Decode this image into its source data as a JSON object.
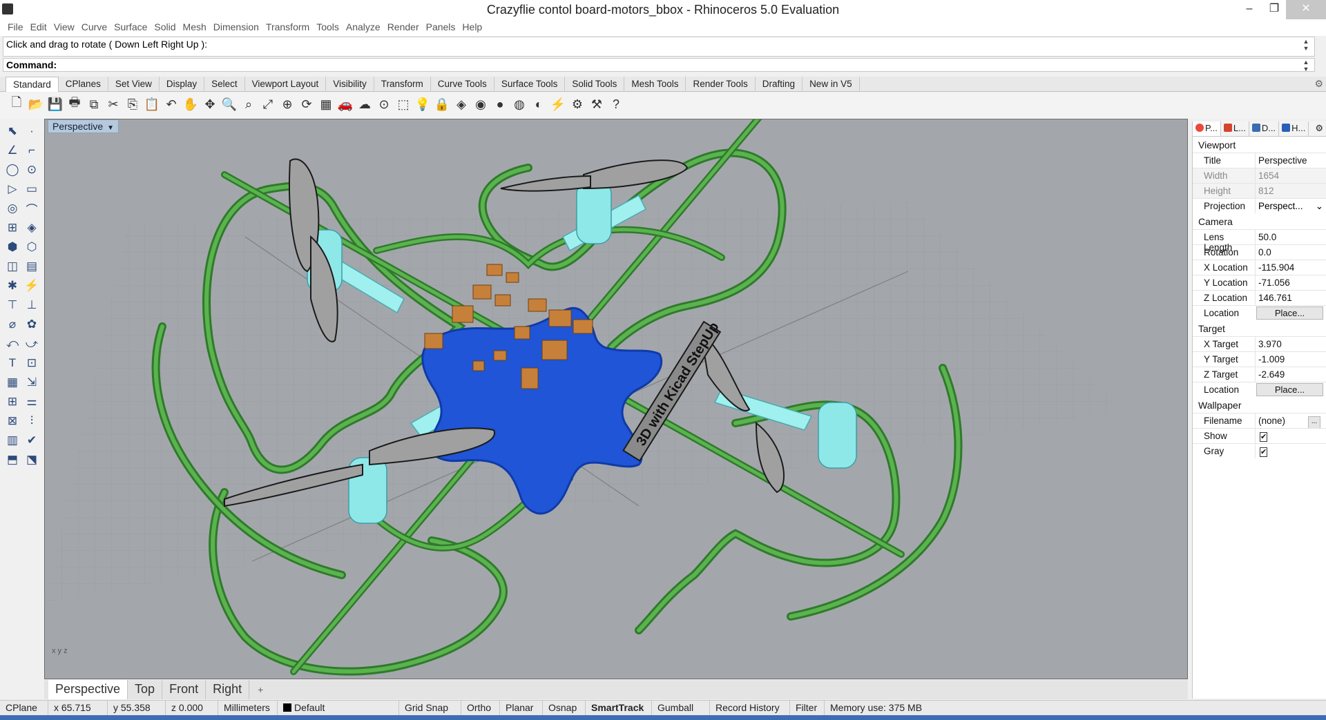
{
  "window": {
    "title": "Crazyflie contol board-motors_bbox - Rhinoceros 5.0 Evaluation",
    "minimize": "–",
    "maximize": "❐",
    "close": "✕"
  },
  "menu": [
    "File",
    "Edit",
    "View",
    "Curve",
    "Surface",
    "Solid",
    "Mesh",
    "Dimension",
    "Transform",
    "Tools",
    "Analyze",
    "Render",
    "Panels",
    "Help"
  ],
  "command": {
    "history": "Click and drag to rotate ( Down  Left  Right  Up ):",
    "prompt": "Command:"
  },
  "toolbar_tabs": [
    "Standard",
    "CPlanes",
    "Set View",
    "Display",
    "Select",
    "Viewport Layout",
    "Visibility",
    "Transform",
    "Curve Tools",
    "Surface Tools",
    "Solid Tools",
    "Mesh Tools",
    "Render Tools",
    "Drafting",
    "New in V5"
  ],
  "toolbar_icons": [
    "new-file-icon",
    "open-file-icon",
    "save-icon",
    "print-icon",
    "export-icon",
    "cut-icon",
    "copy-icon",
    "paste-icon",
    "undo-icon",
    "pan-icon",
    "move-icon",
    "zoom-icon",
    "zoom-window-icon",
    "zoom-extents-icon",
    "zoom-selected-icon",
    "rotate-view-icon",
    "grid-icon",
    "car-icon",
    "shade-icon",
    "properties-icon",
    "select-icon",
    "lightbulb-icon",
    "lock-icon",
    "layer-icon",
    "color-icon",
    "material-icon",
    "render-sphere-icon",
    "render-icon",
    "light-icon",
    "settings-gear-icon",
    "tools-icon",
    "help-icon"
  ],
  "toolbar_glyphs": [
    "🗋",
    "📂",
    "💾",
    "🖶",
    "⧉",
    "✂",
    "⎘",
    "📋",
    "↶",
    "✋",
    "✥",
    "🔍",
    "⌕",
    "⤢",
    "⊕",
    "⟳",
    "▦",
    "🚗",
    "☁",
    "⊙",
    "⬚",
    "💡",
    "🔒",
    "◈",
    "◉",
    "●",
    "◍",
    "◐",
    "⚡",
    "⚙",
    "⚒",
    "?"
  ],
  "left_tools": [
    "⬉",
    "·",
    "∠",
    "⌐",
    "◯",
    "⊙",
    "▷",
    "▭",
    "◎",
    "⌒",
    "⊞",
    "◈",
    "⬢",
    "⬡",
    "◫",
    "▤",
    "✱",
    "⚡",
    "⊤",
    "⊥",
    "⌀",
    "✿",
    "⤺",
    "⤻",
    "T",
    "⊡",
    "▦",
    "⇲",
    "⊞",
    "⚌",
    "⊠",
    "⫶",
    "▥",
    "✔",
    "⬒",
    "⬔"
  ],
  "viewport": {
    "title": "Perspective",
    "axes": "x y z",
    "model_text": "3D with Kicad StepUp"
  },
  "viewport_tabs": [
    "Perspective",
    "Top",
    "Front",
    "Right"
  ],
  "viewport_tab_add": "+",
  "status": {
    "cplane": "CPlane",
    "x": "x 65.715",
    "y": "y 55.358",
    "z": "z 0.000",
    "units": "Millimeters",
    "layer": "Default",
    "grid_snap": "Grid Snap",
    "ortho": "Ortho",
    "planar": "Planar",
    "osnap": "Osnap",
    "smarttrack": "SmartTrack",
    "gumball": "Gumball",
    "record_history": "Record History",
    "filter": "Filter",
    "memory": "Memory use: 375 MB"
  },
  "panel": {
    "tabs": [
      {
        "label": "P...",
        "icon_color": "#e94a3b"
      },
      {
        "label": "L...",
        "icon_color": "#d4432f"
      },
      {
        "label": "D...",
        "icon_color": "#3a6db0"
      },
      {
        "label": "H...",
        "icon_color": "#2a5fb8"
      }
    ],
    "viewport_heading": "Viewport",
    "title_label": "Title",
    "title_value": "Perspective",
    "width_label": "Width",
    "width_value": "1654",
    "height_label": "Height",
    "height_value": "812",
    "projection_label": "Projection",
    "projection_value": "Perspect...",
    "camera_heading": "Camera",
    "lens_label": "Lens Length",
    "lens_value": "50.0",
    "rotation_label": "Rotation",
    "rotation_value": "0.0",
    "xloc_label": "X Location",
    "xloc_value": "-115.904",
    "yloc_label": "Y Location",
    "yloc_value": "-71.056",
    "zloc_label": "Z Location",
    "zloc_value": "146.761",
    "location_label": "Location",
    "place_button": "Place...",
    "target_heading": "Target",
    "xtarget_label": "X Target",
    "xtarget_value": "3.970",
    "ytarget_label": "Y Target",
    "ytarget_value": "-1.009",
    "ztarget_label": "Z Target",
    "ztarget_value": "-2.649",
    "tlocation_label": "Location",
    "tplace_button": "Place...",
    "wallpaper_heading": "Wallpaper",
    "filename_label": "Filename",
    "filename_value": "(none)",
    "browse_button": "...",
    "show_label": "Show",
    "show_checked": "✔",
    "gray_label": "Gray",
    "gray_checked": "✔"
  },
  "colors": {
    "viewport_bg": "#a3a7ac",
    "frame_green": "#4c9e45",
    "board_blue": "#1f55d6",
    "component_orange": "#c7803a",
    "motor_cyan": "#8fe8e8",
    "propeller_gray": "#8d8d8d"
  }
}
